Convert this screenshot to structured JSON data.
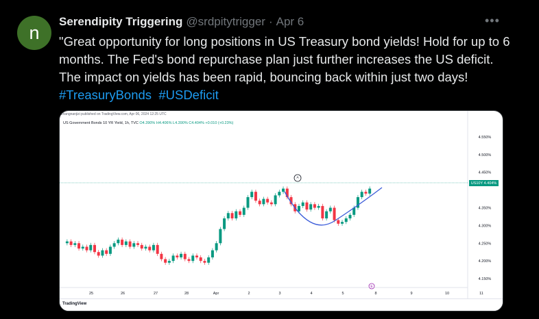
{
  "author": {
    "initial": "n",
    "name": "Serendipity Triggering",
    "handle": "@srdpitytrigger",
    "separator": "·",
    "date": "Apr 6",
    "avatar_color": "#3e7128"
  },
  "more_icon": "more-dots-icon",
  "tweet": {
    "text": "\"Great opportunity for long positions in US Treasury bond yields! Hold for up to 6 months. The Fed's bond repurchase plan just further increases the US deficit. The impact on yields has been rapid, bouncing back within just two days! ",
    "hashtags": [
      "#TreasuryBonds",
      "#USDeficit"
    ]
  },
  "chart_image": {
    "caption": "zhangnanjizi published on TradingView.com, Apr 06, 2024 12:25 UTC",
    "legend_title": "US Government Bonds 10 YR Yield, 1h, TVC",
    "legend_values": "O4.390%  H4.406%  L4.390%  C4.404%  +0.010 (+0.23%)",
    "price_tag": "US10Y  4.404%",
    "branding": "TradingView",
    "events_marker": "E",
    "colors": {
      "up": "#089981",
      "down": "#f23645",
      "curve": "#3a5bd9",
      "line": "#089981"
    }
  },
  "chart_data": {
    "type": "candlestick",
    "title": "US Government Bonds 10 YR Yield, 1h, TVC",
    "x_ticks": [
      "25",
      "26",
      "27",
      "28",
      "Apr",
      "2",
      "3",
      "4",
      "5",
      "8",
      "9",
      "10",
      "11"
    ],
    "y_ticks": [
      "4.550%",
      "4.500%",
      "4.450%",
      "4.350%",
      "4.300%",
      "4.250%",
      "4.200%",
      "4.150%"
    ],
    "y_range": [
      4.125,
      4.575
    ],
    "current_value": 4.404,
    "annotations": [
      "Circled top near 4.404% on Apr 3",
      "Rounded bottom (cup) curve from Apr 3 to Apr 5"
    ],
    "close_path": [
      4.255,
      4.245,
      4.25,
      4.235,
      4.24,
      4.23,
      4.245,
      4.225,
      4.215,
      4.23,
      4.22,
      4.24,
      4.25,
      4.26,
      4.245,
      4.255,
      4.24,
      4.25,
      4.245,
      4.235,
      4.24,
      4.23,
      4.245,
      4.22,
      4.205,
      4.195,
      4.2,
      4.215,
      4.21,
      4.22,
      4.205,
      4.2,
      4.215,
      4.21,
      4.2,
      4.195,
      4.21,
      4.23,
      4.25,
      4.29,
      4.32,
      4.335,
      4.32,
      4.34,
      4.33,
      4.35,
      4.38,
      4.395,
      4.37,
      4.36,
      4.375,
      4.365,
      4.36,
      4.385,
      4.395,
      4.404,
      4.38,
      4.36,
      4.34,
      4.355,
      4.365,
      4.345,
      4.36,
      4.35,
      4.355,
      4.32,
      4.34,
      4.35,
      4.315,
      4.305,
      4.31,
      4.32,
      4.33,
      4.35,
      4.38,
      4.395,
      4.39,
      4.404
    ]
  }
}
